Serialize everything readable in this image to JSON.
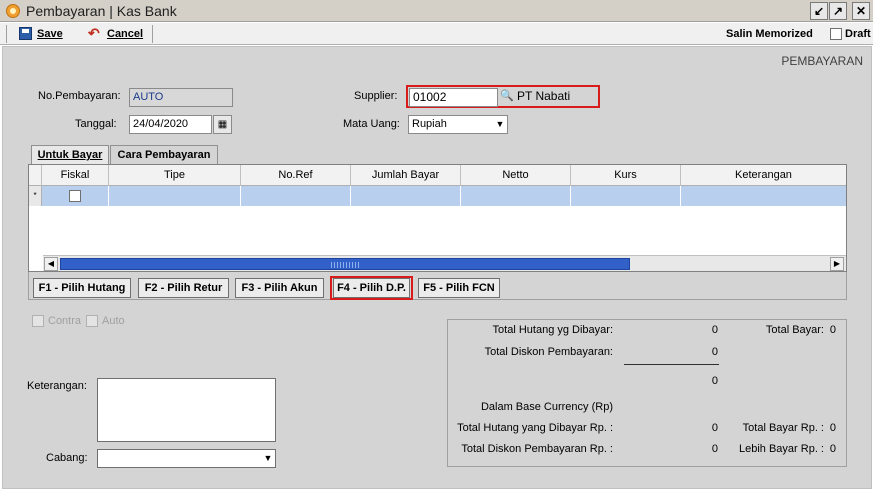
{
  "window": {
    "title": "Pembayaran | Kas Bank",
    "buttons": {
      "restore": "↙",
      "maximize": "↗",
      "close": "✕"
    }
  },
  "toolbar": {
    "save_label": "Save",
    "cancel_label": "Cancel",
    "salin_memorized_label": "Salin Memorized",
    "draft_label": "Draft"
  },
  "form": {
    "section_title": "PEMBAYARAN",
    "no_pembayaran_label": "No.Pembayaran:",
    "no_pembayaran_value": "AUTO",
    "tanggal_label": "Tanggal:",
    "tanggal_value": "24/04/2020",
    "supplier_label": "Supplier:",
    "supplier_code": "01002",
    "supplier_name": "PT Nabati",
    "mata_uang_label": "Mata Uang:",
    "mata_uang_value": "Rupiah"
  },
  "tabs": [
    {
      "label": "Untuk Bayar"
    },
    {
      "label": "Cara Pembayaran"
    }
  ],
  "grid": {
    "columns": [
      "Fiskal",
      "Tipe",
      "No.Ref",
      "Jumlah Bayar",
      "Netto",
      "Kurs",
      "Keterangan"
    ],
    "row_marker": "*"
  },
  "fbuttons": [
    {
      "label": "F1 - Pilih Hutang"
    },
    {
      "label": "F2 - Pilih Retur"
    },
    {
      "label": "F3 - Pilih Akun"
    },
    {
      "label": "F4 - Pilih D.P."
    },
    {
      "label": "F5 - Pilih FCN"
    }
  ],
  "options": {
    "contra_label": "Contra",
    "auto_label": "Auto"
  },
  "bottom": {
    "keterangan_label": "Keterangan:",
    "cabang_label": "Cabang:"
  },
  "totals": {
    "total_hutang_label": "Total Hutang yg Dibayar:",
    "total_hutang_value": "0",
    "total_diskon_label": "Total Diskon Pembayaran:",
    "total_diskon_value": "0",
    "subtotal_value": "0",
    "base_currency_label": "Dalam Base Currency (Rp)",
    "total_hutang_rp_label": "Total Hutang yang Dibayar Rp. :",
    "total_hutang_rp_value": "0",
    "total_diskon_rp_label": "Total Diskon Pembayaran Rp. :",
    "total_diskon_rp_value": "0",
    "total_bayar_label": "Total Bayar:",
    "total_bayar_value": "0",
    "total_bayar_rp_label": "Total Bayar Rp. :",
    "total_bayar_rp_value": "0",
    "lebih_bayar_rp_label": "Lebih Bayar Rp. :",
    "lebih_bayar_rp_value": "0"
  },
  "colors": {
    "highlight": "#d81b1b",
    "selected_row": "#b8d0ee",
    "scroll_thumb": "#3060c8"
  }
}
